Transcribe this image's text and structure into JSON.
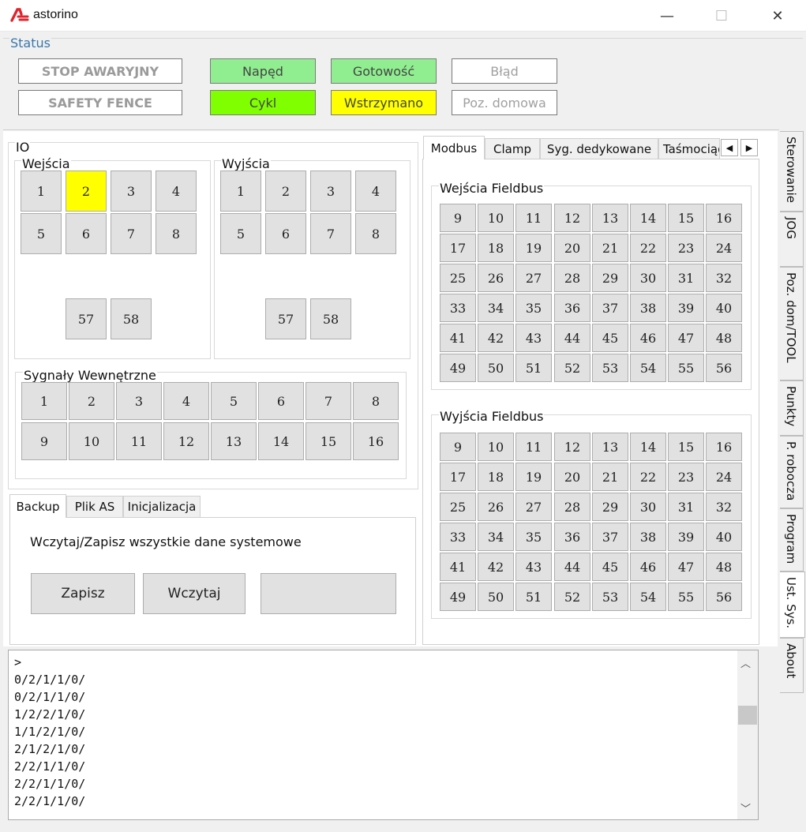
{
  "window": {
    "title": "astorino",
    "minimize": "—",
    "maximize": "☐",
    "close": "✕"
  },
  "status": {
    "label": "Status",
    "boxes": [
      {
        "label": "STOP AWARYJNY"
      },
      {
        "label": "Napęd"
      },
      {
        "label": "Gotowość"
      },
      {
        "label": "Błąd"
      },
      {
        "label": "SAFETY FENCE"
      },
      {
        "label": "Cykl"
      },
      {
        "label": "Wstrzymano"
      },
      {
        "label": "Poz. domowa"
      }
    ],
    "colors": {
      "napęd": "#90ee90",
      "gotowość": "#90ee90",
      "cykl": "#7fff00",
      "wstrzymano": "#ffff00"
    }
  },
  "io": {
    "title": "IO",
    "inputs": {
      "title": "Wejścia",
      "buttons": [
        "1",
        "2",
        "3",
        "4",
        "5",
        "6",
        "7",
        "8",
        "57",
        "58"
      ],
      "active": [
        "2"
      ]
    },
    "outputs": {
      "title": "Wyjścia",
      "buttons": [
        "1",
        "2",
        "3",
        "4",
        "5",
        "6",
        "7",
        "8",
        "57",
        "58"
      ]
    },
    "internal": {
      "title": "Sygnały Wewnętrzne",
      "buttons": [
        "1",
        "2",
        "3",
        "4",
        "5",
        "6",
        "7",
        "8",
        "9",
        "10",
        "11",
        "12",
        "13",
        "14",
        "15",
        "16"
      ]
    }
  },
  "bottom_tabs": {
    "tabs": [
      "Backup",
      "Plik AS",
      "Inicjalizacja"
    ],
    "active": "Backup",
    "description": "Wczytaj/Zapisz wszystkie dane systemowe",
    "save_label": "Zapisz",
    "load_label": "Wczytaj",
    "third_label": ""
  },
  "right_tabs": {
    "tabs": [
      "Modbus",
      "Clamp",
      "Syg. dedykowane",
      "Taśmociąg"
    ],
    "active": "Modbus"
  },
  "modbus": {
    "inputs_title": "Wejścia Fieldbus",
    "outputs_title": "Wyjścia Fieldbus",
    "numbers": [
      "9",
      "10",
      "11",
      "12",
      "13",
      "14",
      "15",
      "16",
      "17",
      "18",
      "19",
      "20",
      "21",
      "22",
      "23",
      "24",
      "25",
      "26",
      "27",
      "28",
      "29",
      "30",
      "31",
      "32",
      "33",
      "34",
      "35",
      "36",
      "37",
      "38",
      "39",
      "40",
      "41",
      "42",
      "43",
      "44",
      "45",
      "46",
      "47",
      "48",
      "49",
      "50",
      "51",
      "52",
      "53",
      "54",
      "55",
      "56"
    ]
  },
  "side_tabs": [
    {
      "label": "Sterowanie"
    },
    {
      "label": "JOG"
    },
    {
      "label": "Poz. dom/TOOL"
    },
    {
      "label": "Punkty"
    },
    {
      "label": "P. robocza"
    },
    {
      "label": "Program"
    },
    {
      "label": "Ust. Sys."
    },
    {
      "label": "About"
    }
  ],
  "side_active": "Ust. Sys.",
  "console": {
    "lines": [
      ">",
      "0/2/1/1/0/",
      "0/2/1/1/0/",
      "1/2/2/1/0/",
      "1/1/2/1/0/",
      "2/1/2/1/0/",
      "2/2/1/1/0/",
      "2/2/1/1/0/",
      "2/2/1/1/0/"
    ]
  }
}
